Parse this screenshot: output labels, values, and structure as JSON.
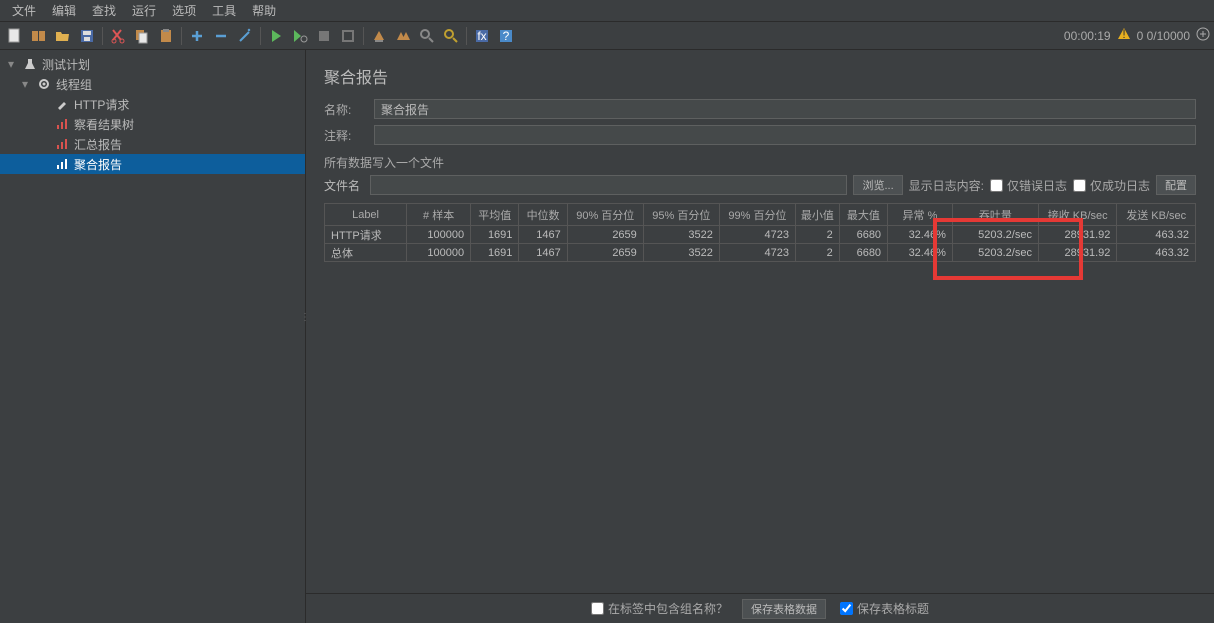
{
  "menu": [
    "文件",
    "编辑",
    "查找",
    "运行",
    "选项",
    "工具",
    "帮助"
  ],
  "status": {
    "time": "00:00:19",
    "threads": "0  0/10000"
  },
  "tree": {
    "root": "测试计划",
    "group": "线程组",
    "items": [
      "HTTP请求",
      "察看结果树",
      "汇总报告",
      "聚合报告"
    ]
  },
  "panel": {
    "title": "聚合报告",
    "name_label": "名称:",
    "name_value": "聚合报告",
    "comment_label": "注释:",
    "comment_value": "",
    "filesection": "所有数据写入一个文件",
    "filename_label": "文件名",
    "filename_value": "",
    "browse": "浏览...",
    "logshow": "显示日志内容:",
    "onlyerror": "仅错误日志",
    "onlysuccess": "仅成功日志",
    "configure": "配置"
  },
  "table": {
    "headers": [
      "Label",
      "# 样本",
      "平均值",
      "中位数",
      "90% 百分位",
      "95% 百分位",
      "99% 百分位",
      "最小值",
      "最大值",
      "异常 %",
      "吞吐量",
      "接收 KB/sec",
      "发送 KB/sec"
    ],
    "rows": [
      [
        "HTTP请求",
        "100000",
        "1691",
        "1467",
        "2659",
        "3522",
        "4723",
        "2",
        "6680",
        "32.46%",
        "5203.2/sec",
        "28931.92",
        "463.32"
      ],
      [
        "总体",
        "100000",
        "1691",
        "1467",
        "2659",
        "3522",
        "4723",
        "2",
        "6680",
        "32.46%",
        "5203.2/sec",
        "28931.92",
        "463.32"
      ]
    ]
  },
  "bottom": {
    "includegroup": "在标签中包含组名称？",
    "savetable": "保存表格数据",
    "saveheader": "保存表格标题"
  },
  "chart_data": {
    "type": "table",
    "title": "聚合报告",
    "columns": [
      "Label",
      "# 样本",
      "平均值",
      "中位数",
      "90% 百分位",
      "95% 百分位",
      "99% 百分位",
      "最小值",
      "最大值",
      "异常 %",
      "吞吐量",
      "接收 KB/sec",
      "发送 KB/sec"
    ],
    "rows": [
      {
        "Label": "HTTP请求",
        "samples": 100000,
        "avg": 1691,
        "median": 1467,
        "p90": 2659,
        "p95": 3522,
        "p99": 4723,
        "min": 2,
        "max": 6680,
        "error_pct": 32.46,
        "throughput": "5203.2/sec",
        "recv_kbs": 28931.92,
        "sent_kbs": 463.32
      },
      {
        "Label": "总体",
        "samples": 100000,
        "avg": 1691,
        "median": 1467,
        "p90": 2659,
        "p95": 3522,
        "p99": 4723,
        "min": 2,
        "max": 6680,
        "error_pct": 32.46,
        "throughput": "5203.2/sec",
        "recv_kbs": 28931.92,
        "sent_kbs": 463.32
      }
    ]
  }
}
